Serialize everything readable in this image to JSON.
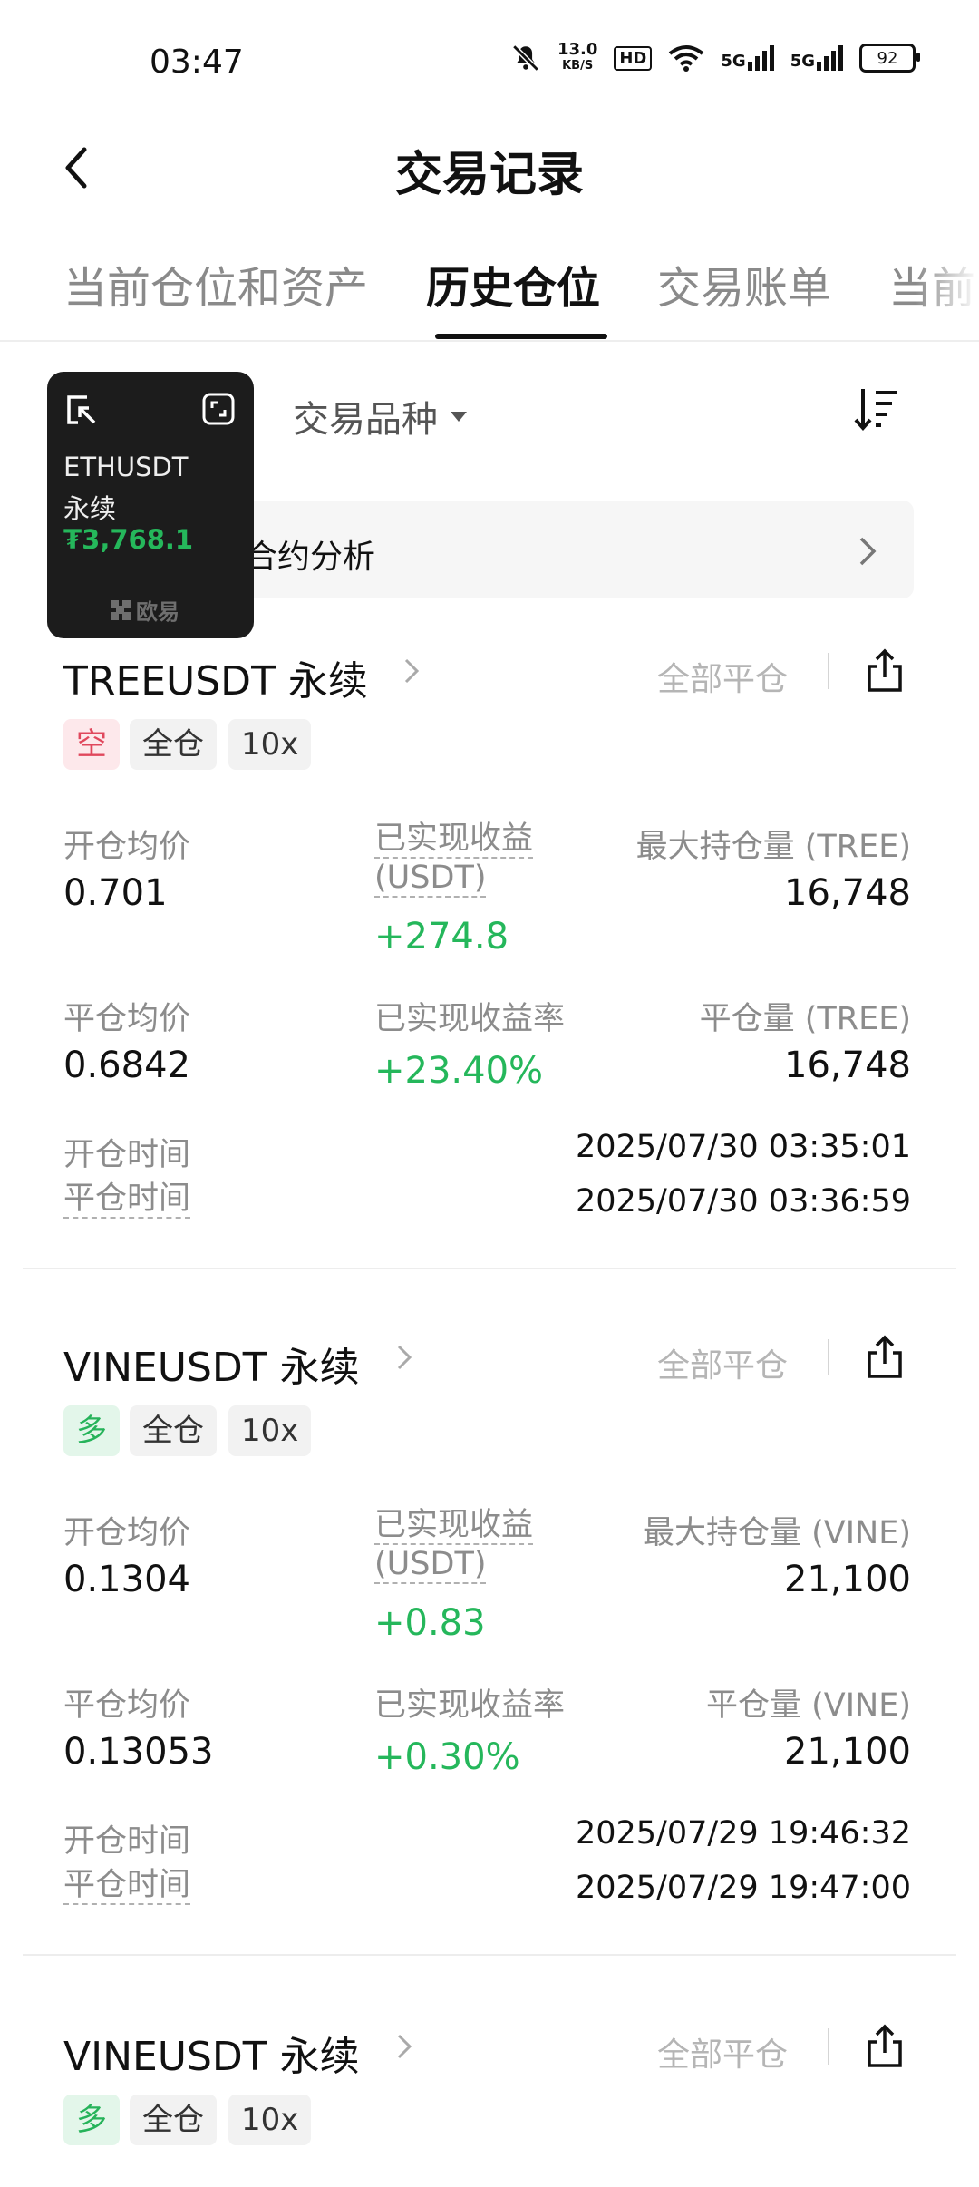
{
  "status_bar": {
    "time": "03:47",
    "net_speed_value": "13.0",
    "net_speed_unit": "KB/S",
    "hd_label": "HD",
    "sim1": "5G",
    "sim2": "5G",
    "battery": "92"
  },
  "header": {
    "title": "交易记录"
  },
  "tabs": [
    {
      "label": "当前仓位和资产"
    },
    {
      "label": "历史仓位"
    },
    {
      "label": "交易账单"
    },
    {
      "label": "当前"
    }
  ],
  "active_tab": "历史仓位",
  "filters": {
    "symbol_label": "交易品种"
  },
  "analysis": {
    "label": "合约分析"
  },
  "widget": {
    "symbol": "ETHUSDT",
    "contract": "永续",
    "price": "₮3,768.1",
    "brand": "欧易"
  },
  "labels": {
    "close_all": "全部平仓",
    "open_avg": "开仓均价",
    "realized_pnl_1": "已实现收益",
    "realized_pnl_2": "(USDT)",
    "close_avg": "平仓均价",
    "realized_rate": "已实现收益率",
    "open_time": "开仓时间",
    "close_time": "平仓时间"
  },
  "positions": [
    {
      "title": "TREEUSDT 永续",
      "side": "空",
      "margin": "全仓",
      "leverage": "10x",
      "max_hold_label": "最大持仓量 (TREE)",
      "close_qty_label": "平仓量 (TREE)",
      "open_avg": "0.701",
      "realized_pnl": "+274.8",
      "max_hold": "16,748",
      "close_avg": "0.6842",
      "realized_rate": "+23.40%",
      "close_qty": "16,748",
      "open_time": "2025/07/30 03:35:01",
      "close_time": "2025/07/30 03:36:59"
    },
    {
      "title": "VINEUSDT 永续",
      "side": "多",
      "margin": "全仓",
      "leverage": "10x",
      "max_hold_label": "最大持仓量 (VINE)",
      "close_qty_label": "平仓量 (VINE)",
      "open_avg": "0.1304",
      "realized_pnl": "+0.83",
      "max_hold": "21,100",
      "close_avg": "0.13053",
      "realized_rate": "+0.30%",
      "close_qty": "21,100",
      "open_time": "2025/07/29 19:46:32",
      "close_time": "2025/07/29 19:47:00"
    },
    {
      "title": "VINEUSDT 永续",
      "side": "多",
      "margin": "全仓",
      "leverage": "10x"
    }
  ],
  "colors": {
    "profit_green": "#25b75b",
    "short_red": "#e0475c",
    "muted_text": "#8c8c8c"
  },
  "icons": [
    "back-arrow-icon",
    "sort-icon",
    "chevron-right-icon",
    "share-icon",
    "collapse-icon",
    "expand-icon"
  ]
}
